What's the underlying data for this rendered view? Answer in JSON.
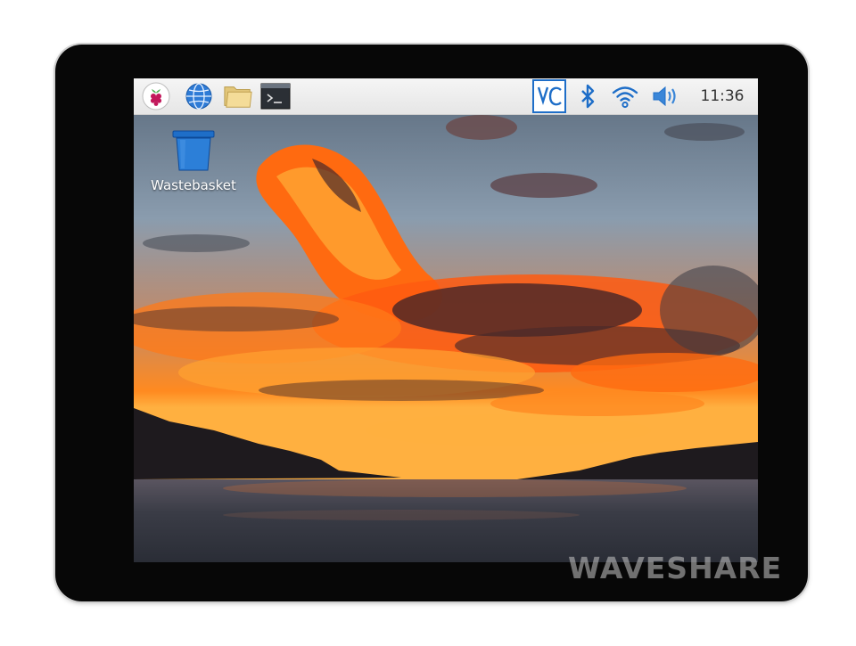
{
  "taskbar": {
    "launchers": [
      {
        "icon": "raspberry-menu-icon"
      },
      {
        "icon": "web-browser-icon"
      },
      {
        "icon": "file-manager-icon"
      },
      {
        "icon": "terminal-icon"
      }
    ],
    "tray": [
      {
        "icon": "vnc-icon"
      },
      {
        "icon": "bluetooth-icon"
      },
      {
        "icon": "wifi-icon"
      },
      {
        "icon": "volume-icon"
      }
    ],
    "clock": "11:36"
  },
  "desktop": {
    "icons": [
      {
        "label": "Wastebasket",
        "icon": "wastebasket-icon"
      }
    ]
  },
  "watermark": "WAVESHARE",
  "colors": {
    "bezel": "#070707",
    "taskbar": "#eeeeee",
    "accent_blue": "#1e6ec8",
    "sky": "#7a8fa3",
    "sunset_orange": "#ff6a10",
    "water": "#3a3f48"
  }
}
